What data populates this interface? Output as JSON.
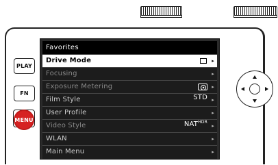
{
  "hardware": {
    "play_label": "PLAY",
    "fn_label": "FN",
    "menu_label": "MENU",
    "menu_button_color": "#d62121"
  },
  "menu": {
    "title": "Favorites",
    "items": [
      {
        "label": "Drive Mode",
        "value": "",
        "icon": "single-frame-icon",
        "selected": true
      },
      {
        "label": "Focusing",
        "value": "",
        "dim": true
      },
      {
        "label": "Exposure Metering",
        "value": "",
        "icon": "spot-metering-icon",
        "dim": true
      },
      {
        "label": "Film Style",
        "value": "STD"
      },
      {
        "label": "User Profile",
        "value": ""
      },
      {
        "label": "Video Style",
        "value": "NAT",
        "value_sup": "HDR",
        "dim": true
      },
      {
        "label": "WLAN",
        "value": ""
      },
      {
        "label": "Main Menu",
        "value": ""
      }
    ],
    "arrow_glyph": "▸"
  }
}
